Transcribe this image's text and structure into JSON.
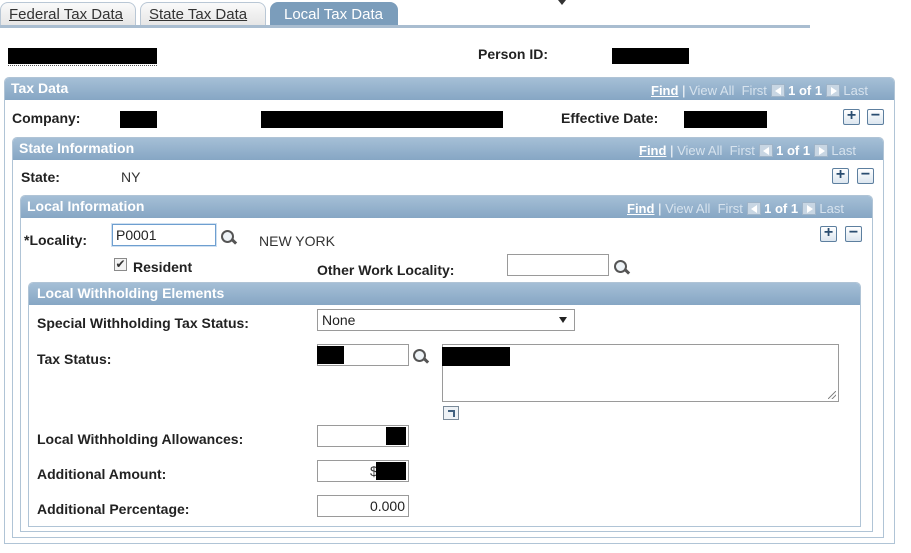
{
  "tabs": [
    {
      "label": "Federal Tax Data",
      "active": false
    },
    {
      "label": "State Tax Data",
      "active": false
    },
    {
      "label": "Local Tax Data",
      "active": true
    }
  ],
  "header": {
    "person_id_label": "Person ID:"
  },
  "nav": {
    "find": "Find",
    "view_all": "View All",
    "first": "First",
    "count": "1 of 1",
    "last": "Last"
  },
  "tax_data": {
    "title": "Tax Data",
    "company_label": "Company:",
    "effective_date_label": "Effective Date:"
  },
  "state_info": {
    "title": "State Information",
    "state_label": "State:",
    "state_value": "NY"
  },
  "local_info": {
    "title": "Local Information",
    "locality_label": "*Locality:",
    "locality_value": "P0001",
    "locality_desc": "NEW YORK",
    "resident_label": "Resident",
    "resident_checked": true,
    "other_work_locality_label": "Other Work Locality:",
    "other_work_locality_value": ""
  },
  "withholding": {
    "title": "Local Withholding Elements",
    "special_status_label": "Special Withholding Tax Status:",
    "special_status_value": "None",
    "tax_status_label": "Tax Status:",
    "allowances_label": "Local Withholding Allowances:",
    "additional_amount_label": "Additional Amount:",
    "additional_amount_prefix": "$",
    "additional_percentage_label": "Additional Percentage:",
    "additional_percentage_value": "0.000"
  },
  "buttons": {
    "plus": "+",
    "minus": "−"
  },
  "colors": {
    "header_blue": "#86a6c4",
    "active_tab": "#7b9dbb"
  }
}
